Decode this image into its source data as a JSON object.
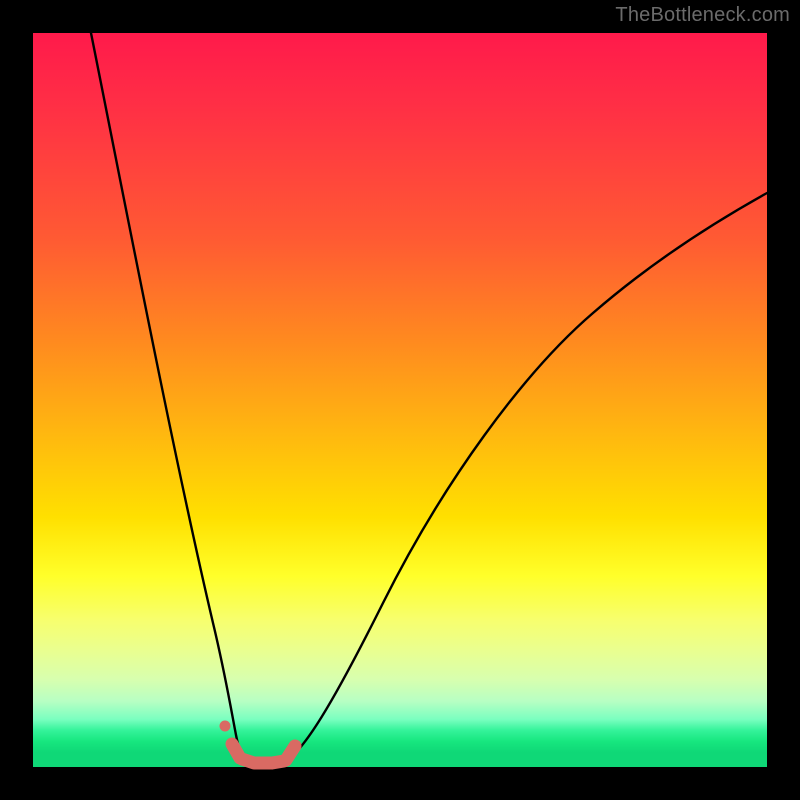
{
  "watermark": "TheBottleneck.com",
  "colors": {
    "frame": "#000000",
    "curve": "#000000",
    "marker_fill": "#d96a63",
    "marker_stroke": "#d96a63"
  },
  "chart_data": {
    "type": "line",
    "title": "",
    "xlabel": "",
    "ylabel": "",
    "xlim": [
      0,
      100
    ],
    "ylim": [
      0,
      100
    ],
    "series": [
      {
        "name": "left-branch",
        "x": [
          8,
          10,
          12,
          14,
          16,
          18,
          20,
          22,
          24,
          25.5,
          26.5,
          27.3
        ],
        "y": [
          100,
          88,
          76,
          64,
          53,
          42,
          32,
          22,
          13,
          7,
          3,
          0.5
        ]
      },
      {
        "name": "right-branch",
        "x": [
          34,
          36,
          40,
          46,
          54,
          62,
          70,
          78,
          86,
          94,
          100
        ],
        "y": [
          0.5,
          3,
          10,
          21,
          34,
          46,
          56,
          64,
          71,
          77,
          81
        ]
      },
      {
        "name": "floor",
        "x": [
          27.3,
          34
        ],
        "y": [
          0.5,
          0.5
        ]
      }
    ],
    "markers": {
      "name": "highlight-segment",
      "points": [
        {
          "x": 26.5,
          "y": 4.0
        },
        {
          "x": 27.3,
          "y": 1.0
        },
        {
          "x": 28.8,
          "y": 0.5
        },
        {
          "x": 30.5,
          "y": 0.5
        },
        {
          "x": 32.2,
          "y": 0.5
        },
        {
          "x": 33.8,
          "y": 1.0
        },
        {
          "x": 35.0,
          "y": 3.2
        }
      ],
      "isolated_point": {
        "x": 25.7,
        "y": 6.8
      }
    }
  }
}
